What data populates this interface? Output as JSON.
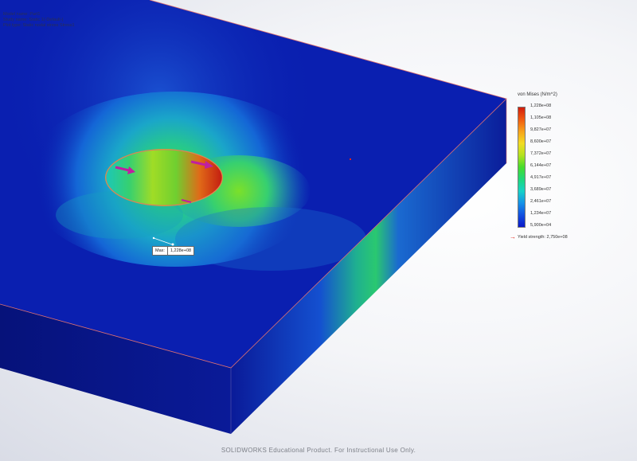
{
  "study_info": {
    "model_name": "Model name: Part1",
    "study_name": "Study name: Static 1(-Default-)",
    "plot_type": "Plot type: Static nodal stress Stress1"
  },
  "legend": {
    "title": "von Mises (N/m^2)",
    "labels": [
      "1,228e+08",
      "1,105e+08",
      "9,827e+07",
      "8,600e+07",
      "7,372e+07",
      "6,144e+07",
      "4,917e+07",
      "3,689e+07",
      "2,461e+07",
      "1,234e+07",
      "5,900e+04"
    ],
    "yield": "Yield strength: 2,750e+08"
  },
  "max_marker": {
    "key": "Max:",
    "value": "1,228e+08"
  },
  "footer": "SOLIDWORKS Educational Product. For Instructional Use Only.",
  "colors": {
    "plate_base": "#0a1fb0",
    "side_face": "#08148a",
    "hot": "#d21d0c",
    "edge_line": "#e07070"
  },
  "icons": {
    "load_arrow": "magenta-arrow-icon",
    "yield_marker": "red-arrow-icon"
  }
}
